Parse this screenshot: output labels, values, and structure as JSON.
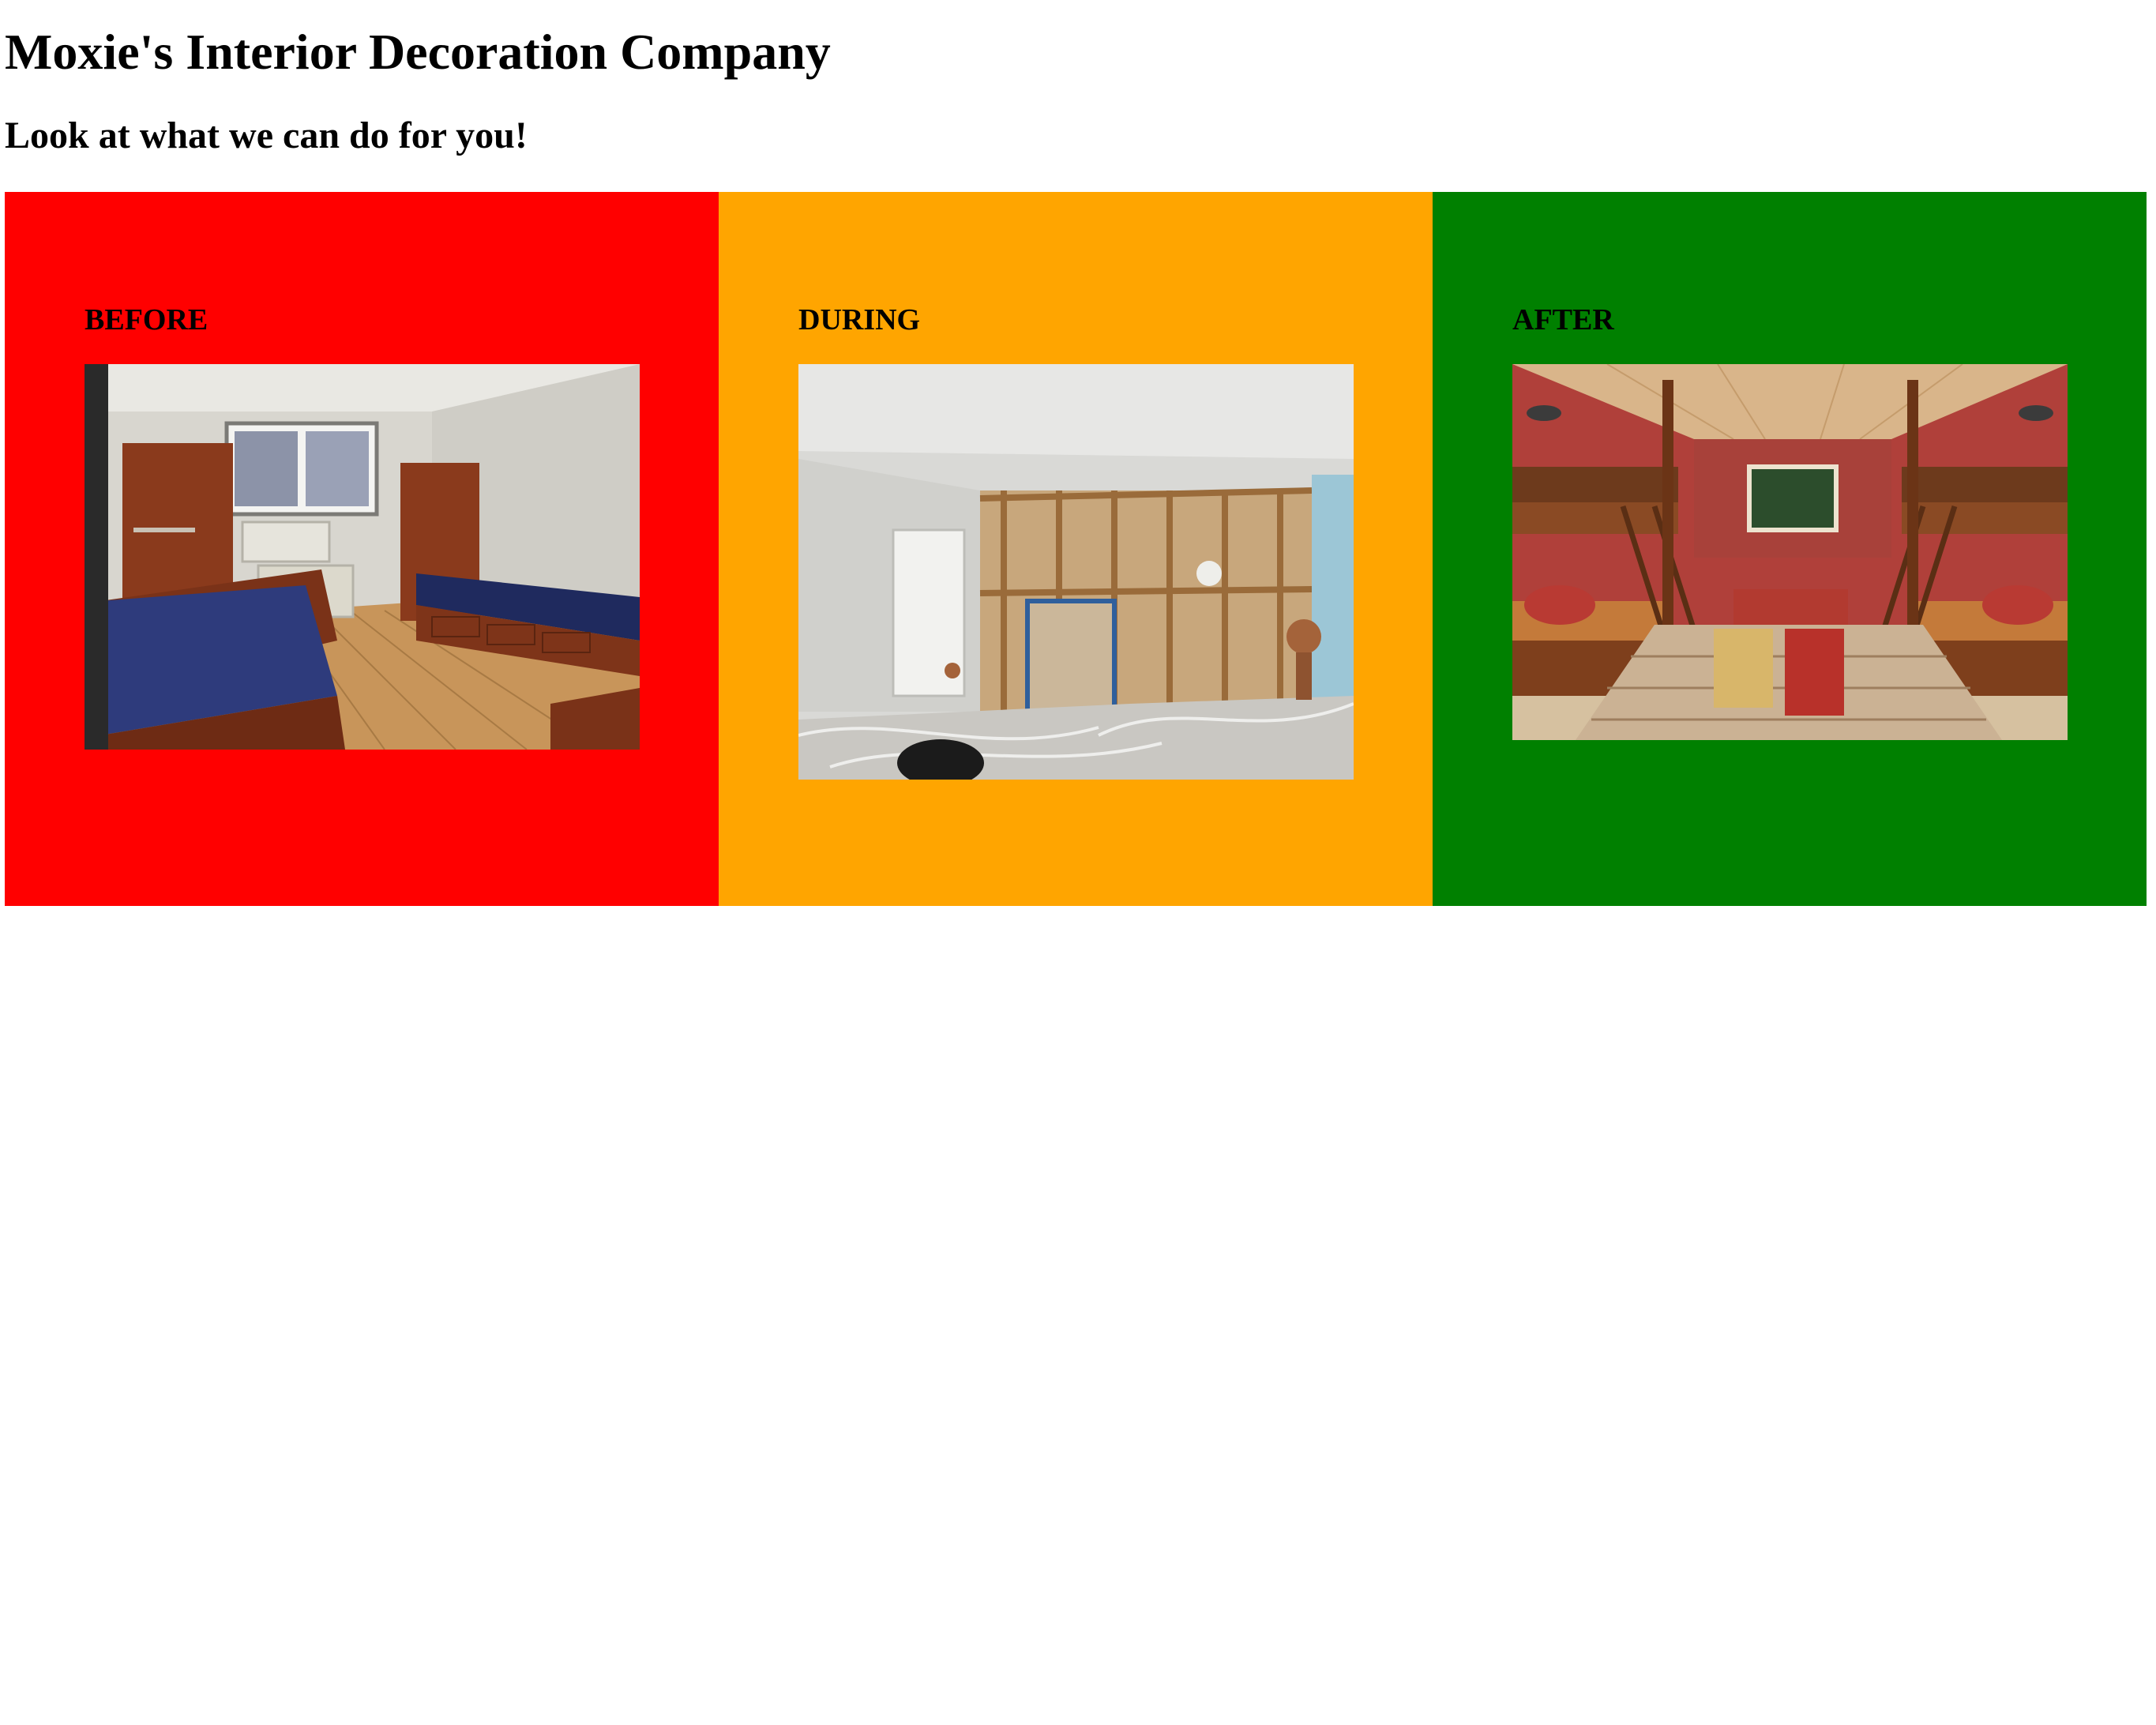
{
  "header": {
    "title": "Moxie's Interior Decoration Company",
    "subtitle": "Look at what we can do for you!"
  },
  "panels": [
    {
      "label": "BEFORE",
      "background": "#ff0000",
      "photo": "empty-dorm-room-photo"
    },
    {
      "label": "DURING",
      "background": "#ffa500",
      "photo": "renovation-in-progress-photo"
    },
    {
      "label": "AFTER",
      "background": "#008000",
      "photo": "finished-bunk-room-photo"
    }
  ]
}
